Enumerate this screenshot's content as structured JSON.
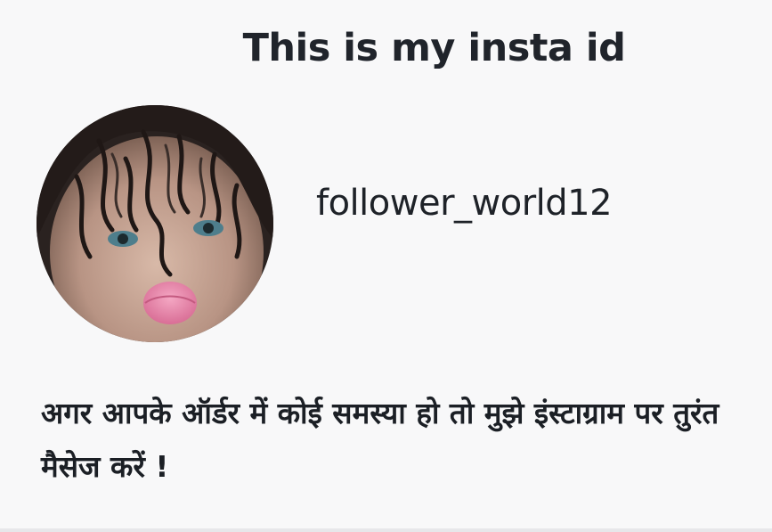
{
  "title": "This is my insta id",
  "profile": {
    "username": "follower_world12",
    "avatar_icon": "profile-photo-avatar"
  },
  "message": "अगर आपके ऑर्डर में कोई समस्या हो तो मुझे इंस्टाग्राम पर तुरंत मैसेज करें !",
  "colors": {
    "background": "#f8f8f9",
    "text": "#1d2128"
  }
}
